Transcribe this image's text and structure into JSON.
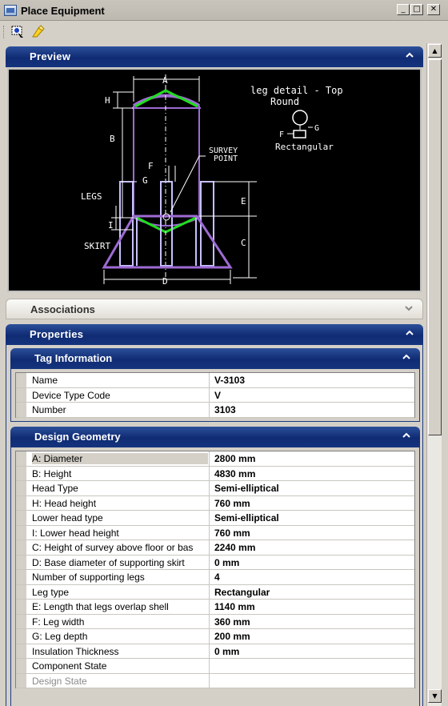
{
  "window": {
    "title": "Place Equipment"
  },
  "toolbar": {
    "buttons": [
      {
        "icon": "select-tool-icon"
      },
      {
        "icon": "pin-tool-icon"
      }
    ]
  },
  "preview": {
    "title": "Preview",
    "drawing": {
      "labels": {
        "A": "A",
        "H": "H",
        "B": "B",
        "F": "F",
        "G": "G",
        "E": "E",
        "I": "I",
        "C": "C",
        "D": "D",
        "legs": "LEGS",
        "skirt": "SKIRT",
        "survey1": "SURVEY",
        "survey2": "POINT",
        "leg_detail": "leg detail - Top",
        "round": "Round",
        "rectangular": "Rectangular"
      }
    }
  },
  "associations": {
    "title": "Associations"
  },
  "properties": {
    "title": "Properties",
    "tag_info": {
      "title": "Tag Information",
      "rows": [
        {
          "name": "Name",
          "value": "V-3103"
        },
        {
          "name": "Device Type Code",
          "value": "V"
        },
        {
          "name": "Number",
          "value": "3103"
        }
      ]
    },
    "design_geometry": {
      "title": "Design Geometry",
      "rows": [
        {
          "name": "A: Diameter",
          "value": "2800 mm"
        },
        {
          "name": "B: Height",
          "value": "4830 mm"
        },
        {
          "name": "Head Type",
          "value": "Semi-elliptical"
        },
        {
          "name": "H: Head height",
          "value": "760 mm"
        },
        {
          "name": "Lower head type",
          "value": "Semi-elliptical"
        },
        {
          "name": "I: Lower head height",
          "value": "760 mm"
        },
        {
          "name": "C: Height of survey above floor or bas",
          "value": "2240 mm"
        },
        {
          "name": "D: Base diameter of supporting skirt",
          "value": "0 mm"
        },
        {
          "name": "Number of supporting legs",
          "value": "4"
        },
        {
          "name": "Leg type",
          "value": "Rectangular"
        },
        {
          "name": "E: Length that legs overlap shell",
          "value": "1140 mm"
        },
        {
          "name": "F: Leg width",
          "value": "360 mm"
        },
        {
          "name": "G: Leg depth",
          "value": "200 mm"
        },
        {
          "name": "Insulation Thickness",
          "value": "0 mm"
        },
        {
          "name": "Component State",
          "value": ""
        },
        {
          "name": "Design State",
          "value": ""
        }
      ]
    }
  },
  "colors": {
    "header_blue": "#15347e",
    "vessel_purple": "#9e6bd3",
    "leg_lavender": "#c8c0ff",
    "head_green": "#22dd22"
  }
}
